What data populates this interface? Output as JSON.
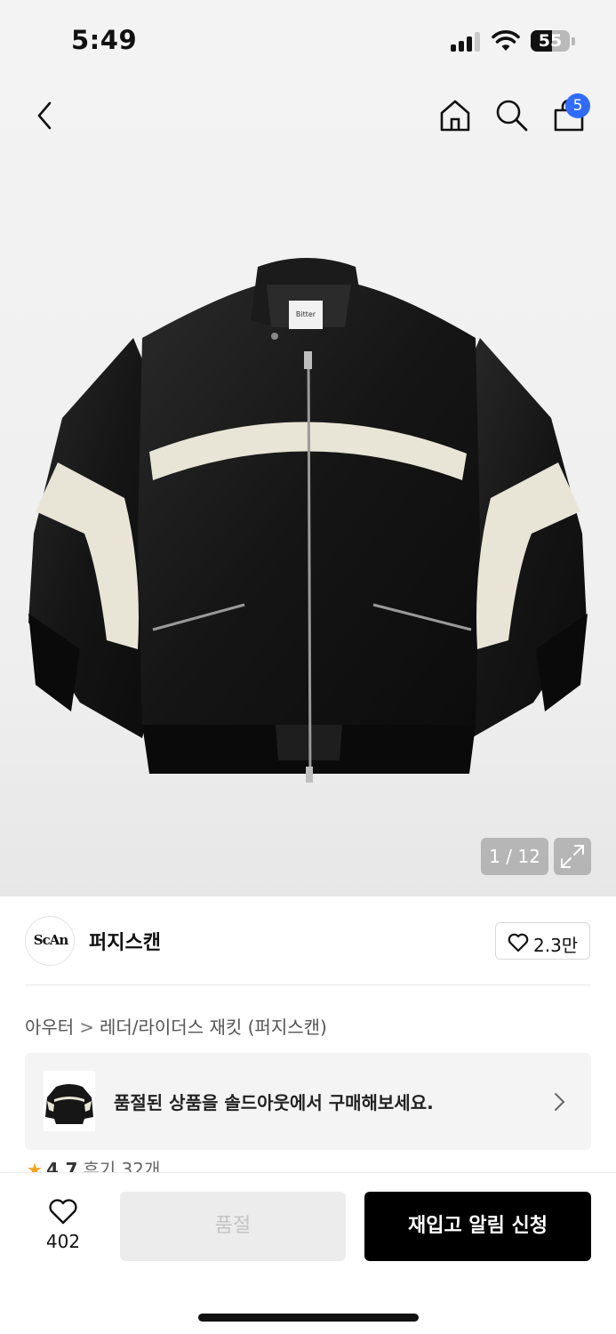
{
  "status_bar": {
    "time": "5:49",
    "battery": "55",
    "battery_level": 0.55
  },
  "header": {
    "cart_count": "5"
  },
  "gallery": {
    "counter": "1 / 12",
    "label_tag": "Bitter"
  },
  "brand": {
    "logo_text": "ScAn",
    "name": "퍼지스캔",
    "likes": "2.3만"
  },
  "breadcrumb": {
    "category": "아우터",
    "separator": ">",
    "subcategory": "레더/라이더스 재킷 (퍼지스캔)"
  },
  "soldout_banner": {
    "text": "품절된 상품을 솔드아웃에서 구매해보세요."
  },
  "rating": {
    "score": "4.7",
    "reviews": "후기 32개"
  },
  "bottom_bar": {
    "wish_count": "402",
    "soldout_label": "품절",
    "restock_label": "재입고 알림 신청"
  },
  "colors": {
    "badge": "#2f6bff",
    "star": "#f5a623",
    "primary_button": "#000000",
    "disabled_button": "#ececec"
  }
}
